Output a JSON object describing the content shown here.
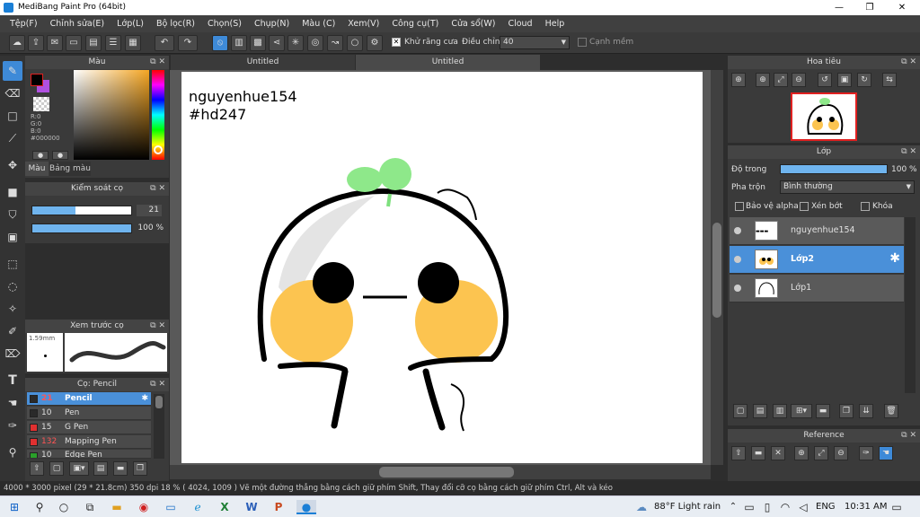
{
  "window": {
    "title": "MediBang Paint Pro (64bit)",
    "minimize": "—",
    "maximize": "❐",
    "close": "✕"
  },
  "menu": [
    "Tệp(F)",
    "Chỉnh sửa(E)",
    "Lớp(L)",
    "Bộ lọc(R)",
    "Chọn(S)",
    "Chụp(N)",
    "Màu (C)",
    "Xem(V)",
    "Công cụ(T)",
    "Cửa sổ(W)",
    "Cloud",
    "Help"
  ],
  "toolbar": {
    "antialias_label": "Khử răng cưa",
    "adjust_label": "Điều chỉnh",
    "adjust_value": "40",
    "smooth_label": "Cạnh mềm"
  },
  "color_panel": {
    "title": "Màu",
    "r": "R:0",
    "g": "G:0",
    "b": "B:0",
    "hex": "#000000",
    "tab_color": "Màu",
    "tab_palette": "Bảng màu"
  },
  "brush_control": {
    "title": "Kiểm soát cọ",
    "size": "21",
    "opacity": "100 %"
  },
  "brush_preview": {
    "title": "Xem trước cọ",
    "size_label": "1.59mm"
  },
  "brush_list": {
    "title": "Cọ: Pencil",
    "items": [
      {
        "size": "21",
        "name": "Pencil",
        "color": "#2a2a2a"
      },
      {
        "size": "10",
        "name": "Pen",
        "color": "#2a2a2a"
      },
      {
        "size": "15",
        "name": "G Pen",
        "color": "#e03030"
      },
      {
        "size": "132",
        "name": "Mapping Pen",
        "color": "#e03030"
      },
      {
        "size": "10",
        "name": "Edge Pen",
        "color": "#2aa02a"
      }
    ]
  },
  "tabs": [
    "Untitled",
    "Untitled"
  ],
  "canvas_text": {
    "line1": "nguyenhue154",
    "line2": "#hd247"
  },
  "navigator": {
    "title": "Hoa tiêu"
  },
  "layers": {
    "title": "Lớp",
    "opacity_label": "Độ trong",
    "opacity_value": "100 %",
    "blend_label": "Pha trộn",
    "blend_value": "Bình thường",
    "protect_alpha": "Bảo vệ alpha",
    "clipping": "Xén bớt",
    "lock": "Khóa",
    "items": [
      {
        "name": "nguyenhue154"
      },
      {
        "name": "Lớp2"
      },
      {
        "name": "Lớp1"
      }
    ]
  },
  "reference": {
    "title": "Reference"
  },
  "status": "4000 * 3000 pixel   (29 * 21.8cm)   350 dpi   18 %   ( 4024, 1009 )   Vẽ một đường thẳng bằng cách giữ phím Shift, Thay đổi cỡ cọ bằng cách giữ phím Ctrl, Alt và kéo",
  "taskbar": {
    "weather": "88°F  Light rain",
    "lang": "ENG",
    "time": "10:31 AM"
  }
}
